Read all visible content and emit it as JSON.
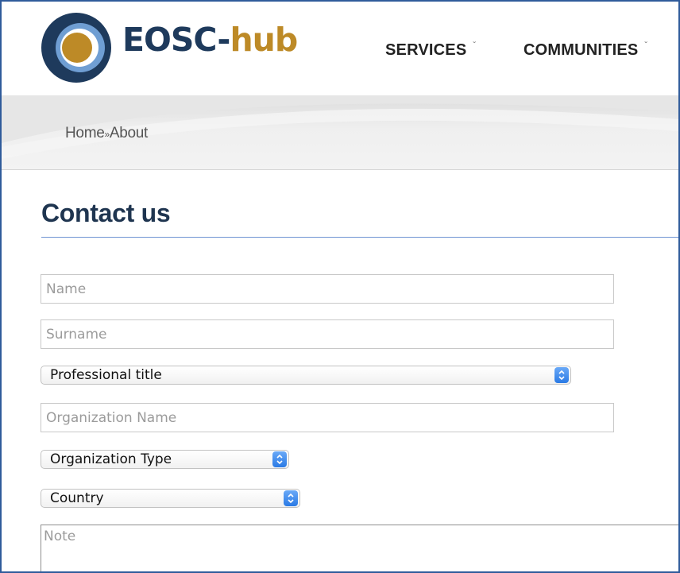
{
  "header": {
    "logo_word_main": "EOSC-",
    "logo_word_accent": "hub",
    "nav": [
      {
        "label": "SERVICES",
        "caret": "ˇ"
      },
      {
        "label": "COMMUNITIES",
        "caret": "ˇ"
      }
    ]
  },
  "breadcrumb": {
    "home": "Home",
    "separator": "»",
    "current": "About"
  },
  "page": {
    "title": "Contact us"
  },
  "form": {
    "name_placeholder": "Name",
    "surname_placeholder": "Surname",
    "professional_title_selected": "Professional title",
    "organization_name_placeholder": "Organization Name",
    "organization_type_selected": "Organization Type",
    "country_selected": "Country",
    "note_placeholder": "Note"
  },
  "colors": {
    "brand_dark": "#1e3a5c",
    "brand_gold": "#bd8a27",
    "select_arrow_blue": "#2a7ae5",
    "title_rule": "#6f94d2"
  },
  "icons": {
    "logo": "eosc-logo-icon",
    "select_arrow": "up-down-chevron-icon"
  }
}
